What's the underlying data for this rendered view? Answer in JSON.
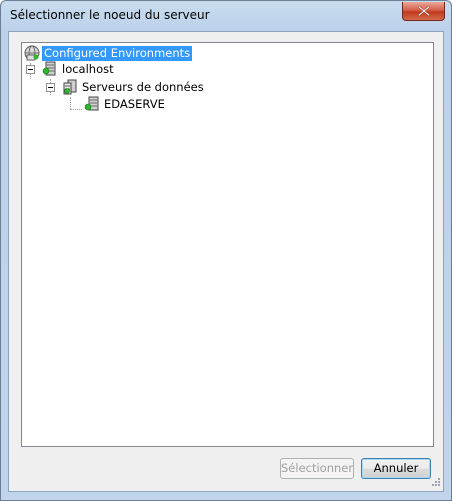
{
  "window": {
    "title": "Sélectionner le noeud du serveur"
  },
  "tree": {
    "root": {
      "label": "Configured Environments",
      "icon": "environments-icon",
      "selected": true,
      "children": [
        {
          "label": "localhost",
          "icon": "server-icon",
          "expanded": true,
          "children": [
            {
              "label": "Serveurs de données",
              "icon": "data-servers-icon",
              "expanded": true,
              "children": [
                {
                  "label": "EDASERVE",
                  "icon": "server-node-icon"
                }
              ]
            }
          ]
        }
      ]
    }
  },
  "buttons": {
    "select": {
      "label": "Sélectionner",
      "enabled": false
    },
    "cancel": {
      "label": "Annuler",
      "enabled": true
    }
  },
  "colors": {
    "selection": "#3399ff",
    "frame": "#bcd2ea",
    "close": "#c7432a"
  }
}
